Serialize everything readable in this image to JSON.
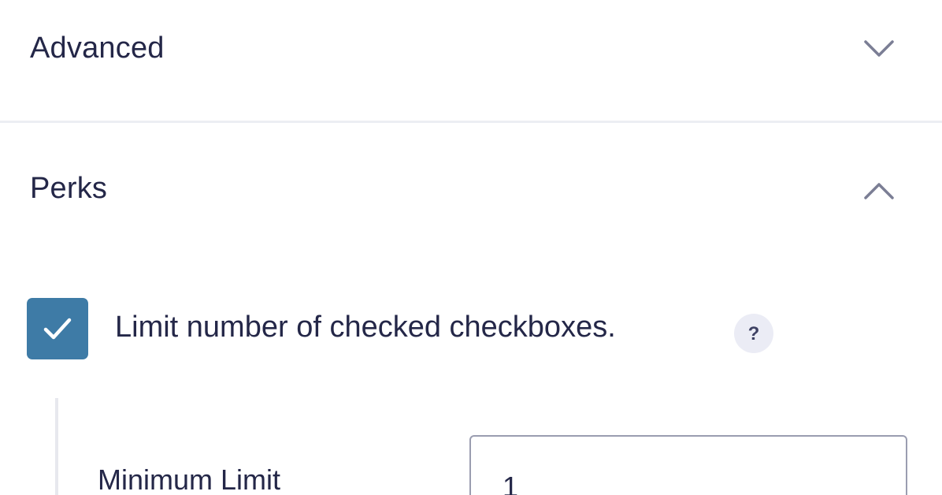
{
  "sections": {
    "advanced": {
      "title": "Advanced",
      "state": "collapsed",
      "icon": "chevron-down-icon"
    },
    "perks": {
      "title": "Perks",
      "state": "expanded",
      "icon": "chevron-up-icon",
      "limit_checkbox": {
        "checked": true,
        "label": "Limit number of checked checkboxes.",
        "help_glyph": "?"
      },
      "minimum_limit": {
        "label": "Minimum Limit",
        "value": "1"
      }
    }
  },
  "colors": {
    "text": "#242748",
    "checkbox_fill": "#3e7ba6",
    "chevron": "#7b7e95",
    "help_badge_bg": "#ebecf5",
    "divider": "#eceef3",
    "input_border": "#9a9db0"
  }
}
